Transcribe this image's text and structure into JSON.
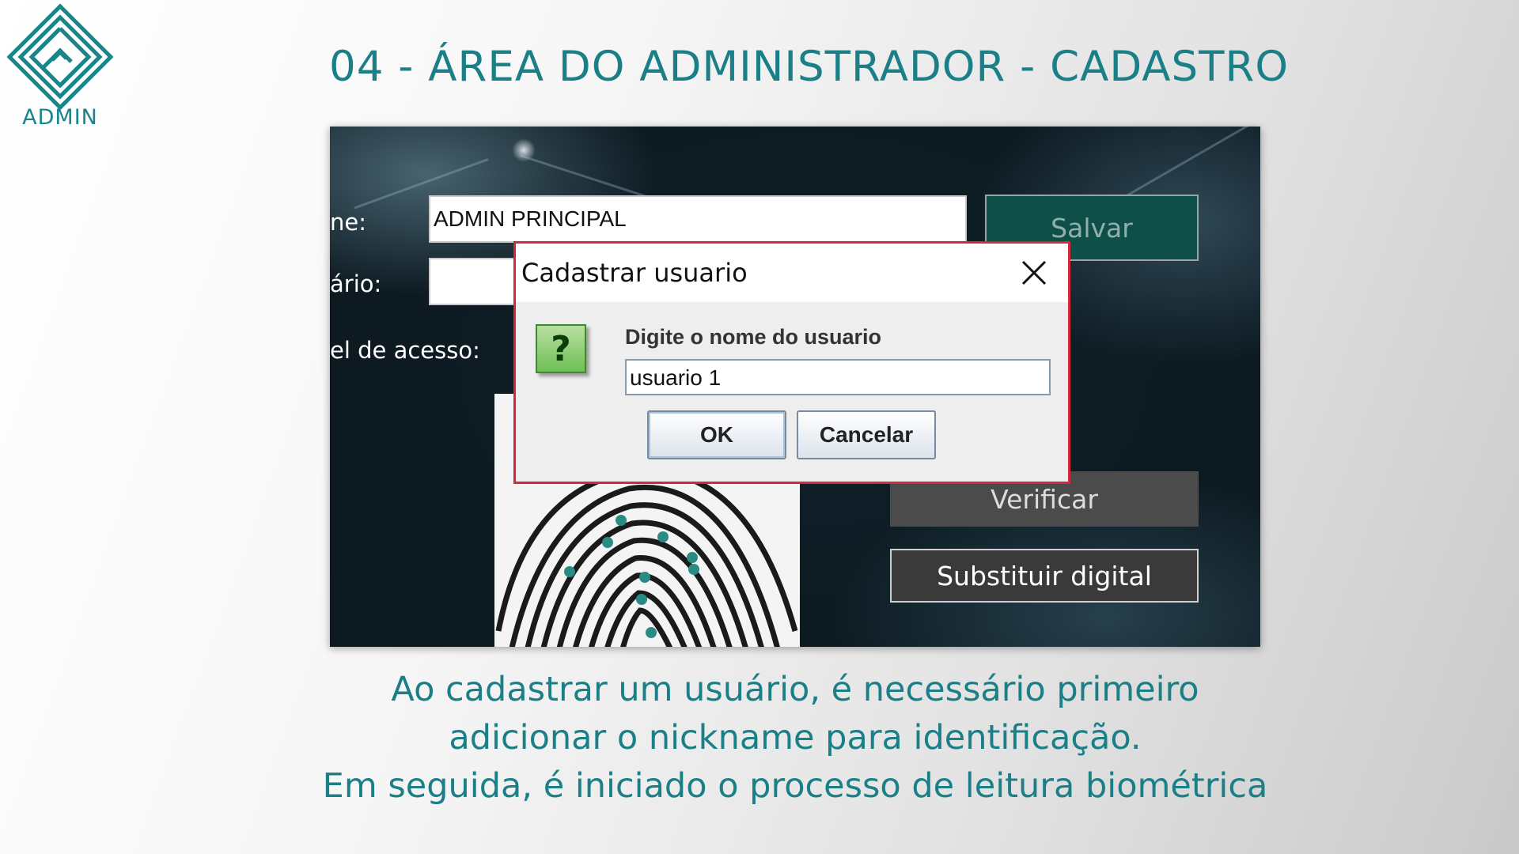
{
  "logo": {
    "text": "ADMIN",
    "icon": "maze-diamond-icon"
  },
  "slide": {
    "title": "04 - ÁREA DO ADMINISTRADOR - CADASTRO"
  },
  "app": {
    "labels": {
      "name": "ne:",
      "user": "ário:",
      "access": "el de acesso:"
    },
    "name_value": "ADMIN PRINCIPAL",
    "buttons": {
      "save": "Salvar",
      "verify": "Verificar",
      "replace": "Substituir digital"
    }
  },
  "dialog": {
    "title": "Cadastrar usuario",
    "message": "Digite o nome do usuario",
    "input_value": "usuario 1",
    "ok": "OK",
    "cancel": "Cancelar",
    "icon": "question-icon"
  },
  "caption": {
    "line1": "Ao cadastrar um usuário, é necessário primeiro",
    "line2": "adicionar o nickname para identificação.",
    "line3": "Em seguida, é iniciado o processo de leitura biométrica"
  },
  "colors": {
    "accent": "#1a7f86",
    "dialog_border": "#d4283c",
    "save_button": "#0e5049"
  }
}
